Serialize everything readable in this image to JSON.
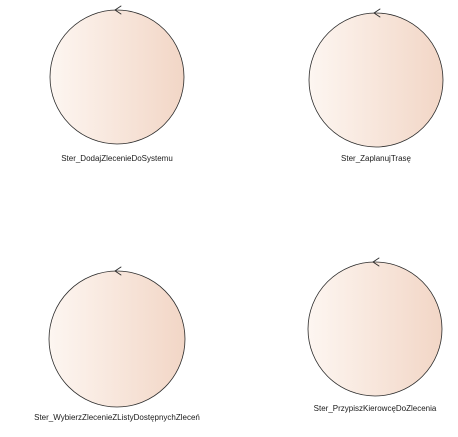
{
  "diagram": {
    "nodes": [
      {
        "id": "n1",
        "label": "Ster_DodajZlecenieDoSystemu"
      },
      {
        "id": "n2",
        "label": "Ster_ZaplanujTrasę"
      },
      {
        "id": "n3",
        "label": "Ster_WybierzZlecenieZListyDostępnychZleceń"
      },
      {
        "id": "n4",
        "label": "Ster_PrzypiszKierowcęDoZlecenia"
      }
    ],
    "colors": {
      "fill_light": "#fdf6f1",
      "fill_dark": "#f2d6c6",
      "stroke": "#2b2b2b",
      "text": "#1a1a1a"
    }
  }
}
